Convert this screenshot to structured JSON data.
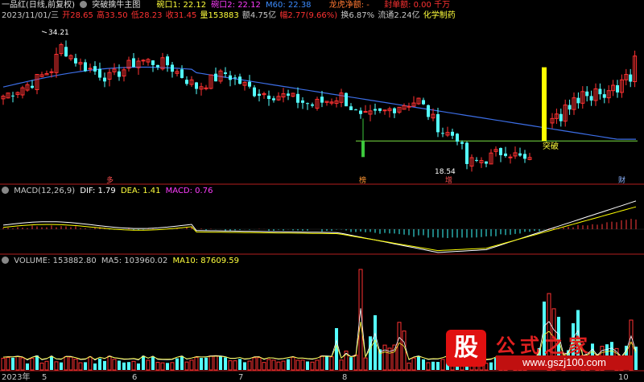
{
  "header": {
    "title": "一品红(日线,前复权)",
    "indicator": "突破擒牛主图",
    "gang1": "碗口1: 22.12",
    "gang2": "碗口2: 22.12",
    "m60": "M60: 22.38",
    "dragon": "龙虎净额: -",
    "seal": "封单额: 0.00 千万",
    "date": "2023/11/01/三",
    "open": "开28.65",
    "high": "高33.50",
    "low": "低28.23",
    "close": "收31.45",
    "volume": "量153883",
    "amount": "额4.75亿",
    "change": "幅2.77(9.66%)",
    "turnover": "换6.87%",
    "float_shares": "流通2.24亿",
    "industry": "化学制药"
  },
  "price_panel": {
    "peak_label": "34.21",
    "low_label": "18.54",
    "breakout_label": "突破",
    "markers": [
      "多",
      "榜",
      "增",
      "财"
    ]
  },
  "macd_panel": {
    "title": "MACD(12,26,9)",
    "dif": "DIF: 1.79",
    "dea": "DEA: 1.41",
    "macd": "MACD: 0.76"
  },
  "volume_panel": {
    "title": "VOLUME: 153882.80",
    "ma5": "MA5: 103960.02",
    "ma10": "MA10: 87609.59"
  },
  "x_axis": {
    "labels": [
      "2023年",
      "5",
      "6",
      "7",
      "8",
      "10"
    ]
  },
  "logo": {
    "glyph": "股",
    "name": "公式之家",
    "url": "www.gszj100.com"
  },
  "colors": {
    "up": "#ff3232",
    "down": "#54ffff",
    "ma60": "#3c6ee6",
    "support": "#6cc83c",
    "breakout": "#ffff00",
    "dif": "#ffffff",
    "dea": "#ffff00"
  },
  "chart_data": [
    {
      "type": "candlestick",
      "title": "一品红(日线,前复权)",
      "x_range": [
        "2023年",
        "10"
      ],
      "ylim": [
        18.54,
        34.21
      ],
      "series": [
        {
          "name": "M60",
          "values": [
            22.38
          ]
        }
      ],
      "annotations": [
        "34.21",
        "18.54",
        "突破"
      ],
      "last_bar": {
        "open": 28.65,
        "high": 33.5,
        "low": 28.23,
        "close": 31.45
      }
    },
    {
      "type": "line",
      "title": "MACD(12,26,9)",
      "series": [
        {
          "name": "DIF",
          "values": [
            1.79
          ]
        },
        {
          "name": "DEA",
          "values": [
            1.41
          ]
        },
        {
          "name": "MACD",
          "values": [
            0.76
          ]
        }
      ]
    },
    {
      "type": "bar",
      "title": "VOLUME",
      "series": [
        {
          "name": "VOLUME",
          "values": [
            153882.8
          ]
        },
        {
          "name": "MA5",
          "values": [
            103960.02
          ]
        },
        {
          "name": "MA10",
          "values": [
            87609.59
          ]
        }
      ]
    }
  ]
}
